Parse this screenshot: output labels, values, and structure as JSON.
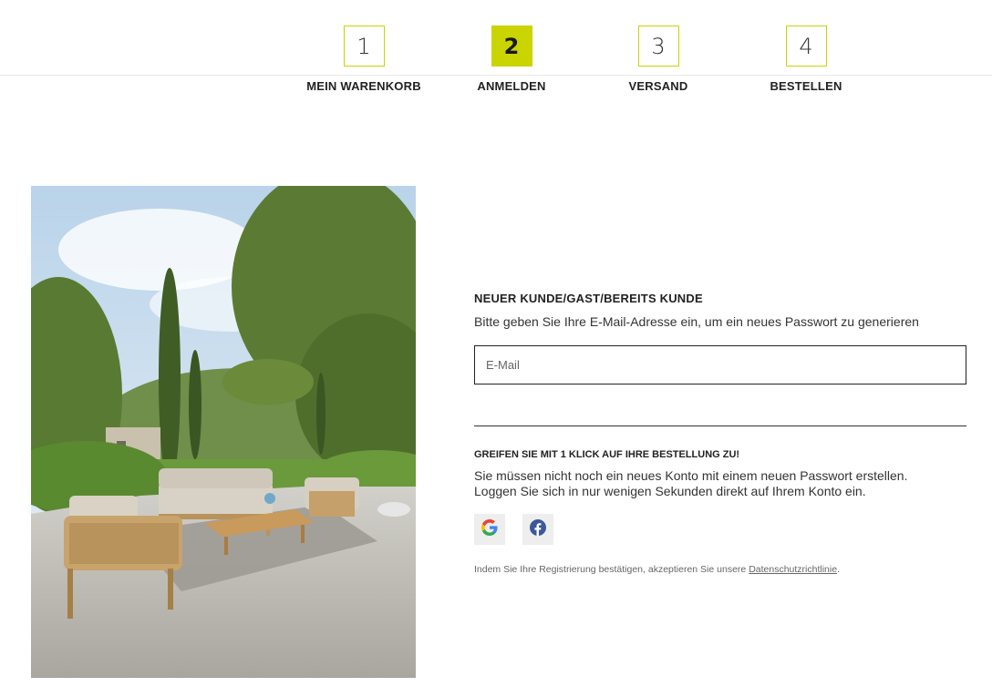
{
  "checkout_steps": [
    {
      "number": "1",
      "label": "MEIN WARENKORB"
    },
    {
      "number": "2",
      "label": "ANMELDEN"
    },
    {
      "number": "3",
      "label": "VERSAND"
    },
    {
      "number": "4",
      "label": "BESTELLEN"
    }
  ],
  "active_step": 2,
  "login": {
    "title": "NEUER KUNDE/GAST/BEREITS KUNDE",
    "subtitle": "Bitte geben Sie Ihre E-Mail-Adresse ein, um ein neues Passwort zu generieren",
    "email_placeholder": "E-Mail"
  },
  "social_login": {
    "title": "GREIFEN SIE MIT 1 KLICK AUF IHRE BESTELLUNG ZU!",
    "line1": "Sie müssen nicht noch ein neues Konto mit einem neuen Passwort erstellen.",
    "line2": "Loggen Sie sich in nur wenigen Sekunden direkt auf Ihrem Konto ein.",
    "providers": [
      {
        "name": "google",
        "icon": "google-icon"
      },
      {
        "name": "facebook",
        "icon": "facebook-icon"
      }
    ]
  },
  "legal": {
    "text": "Indem Sie Ihre Registrierung bestätigen, akzeptieren Sie unsere ",
    "link": "Datenschutzrichtlinie",
    "suffix": "."
  },
  "colors": {
    "accent": "#c9d400",
    "text": "#222222",
    "social_bg": "#eeeeee",
    "facebook": "#3b5998"
  }
}
